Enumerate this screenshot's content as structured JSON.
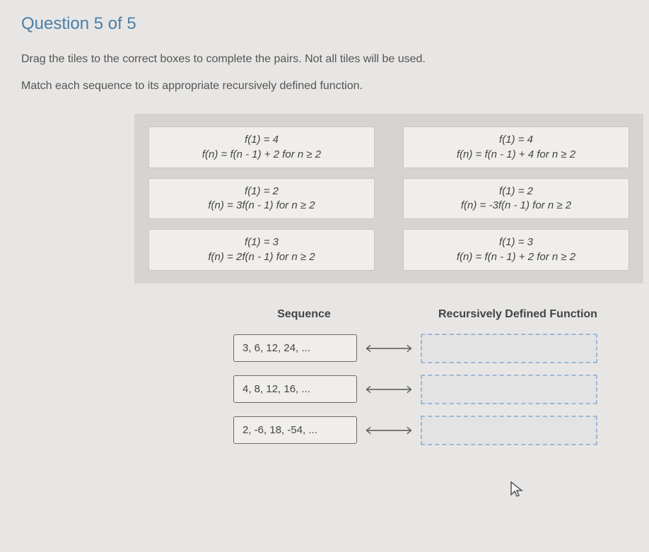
{
  "title": "Question 5 of 5",
  "instruction": "Drag the tiles to the correct boxes to complete the pairs. Not all tiles will be used.",
  "sub_instruction": "Match each sequence to its appropriate recursively defined function.",
  "tiles": [
    {
      "line1": "f(1) = 4",
      "line2": "f(n) = f(n - 1) + 2 for n ≥ 2"
    },
    {
      "line1": "f(1) = 4",
      "line2": "f(n) = f(n - 1) + 4 for n ≥ 2"
    },
    {
      "line1": "f(1) = 2",
      "line2": "f(n) = 3f(n - 1) for n ≥ 2"
    },
    {
      "line1": "f(1) = 2",
      "line2": "f(n) = -3f(n - 1) for n ≥ 2"
    },
    {
      "line1": "f(1) = 3",
      "line2": "f(n) = 2f(n - 1) for n ≥ 2"
    },
    {
      "line1": "f(1) = 3",
      "line2": "f(n) = f(n - 1) + 2 for n ≥ 2"
    }
  ],
  "headers": {
    "sequence": "Sequence",
    "function": "Recursively Defined Function"
  },
  "sequences": [
    "3, 6, 12, 24, ...",
    "4, 8, 12, 16, ...",
    "2, -6, 18, -54, ..."
  ]
}
